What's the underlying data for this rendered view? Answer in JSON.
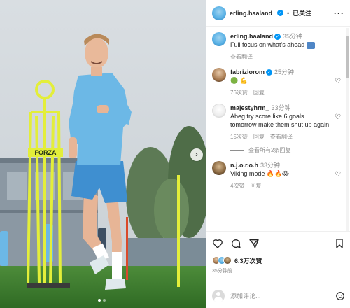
{
  "photo": {
    "sign_text": "FORZA",
    "next_icon": "chevron-right-icon",
    "dot_count": 2,
    "active_dot": 1
  },
  "header": {
    "username": "erling.haaland",
    "separator": "•",
    "follow_status": "已关注",
    "more_label": "···"
  },
  "caption": {
    "username": "erling.haaland",
    "time": "35分钟",
    "text": "Full focus on what's ahead",
    "translate": "查看翻译"
  },
  "comments": [
    {
      "username": "fabriziorom",
      "verified": true,
      "time": "25分钟",
      "text": "🟢 💪",
      "likes": "76次赞",
      "reply": "回复",
      "translate": ""
    },
    {
      "username": "majestyhrm_",
      "verified": false,
      "time": "33分钟",
      "text": "Abeg try score like 6 goals tomorrow make them shut up again",
      "likes": "15次赞",
      "reply": "回复",
      "translate": "查看翻译"
    },
    {
      "username": "n.j.o.r.o.h",
      "verified": false,
      "time": "33分钟",
      "text": "Viking mode 🔥🔥😱",
      "likes": "4次赞",
      "reply": "回复",
      "translate": ""
    }
  ],
  "view_replies": "查看所有2条回复",
  "actions": {
    "likes_count": "6.3万次赞",
    "posted_ago": "35分钟前"
  },
  "add_comment": {
    "placeholder": "添加评论..."
  },
  "colors": {
    "verified": "#0095f6",
    "city_blue": "#6cb8e6",
    "muted": "#8e8e8e",
    "forza_yellow": "#e3ee3a"
  }
}
